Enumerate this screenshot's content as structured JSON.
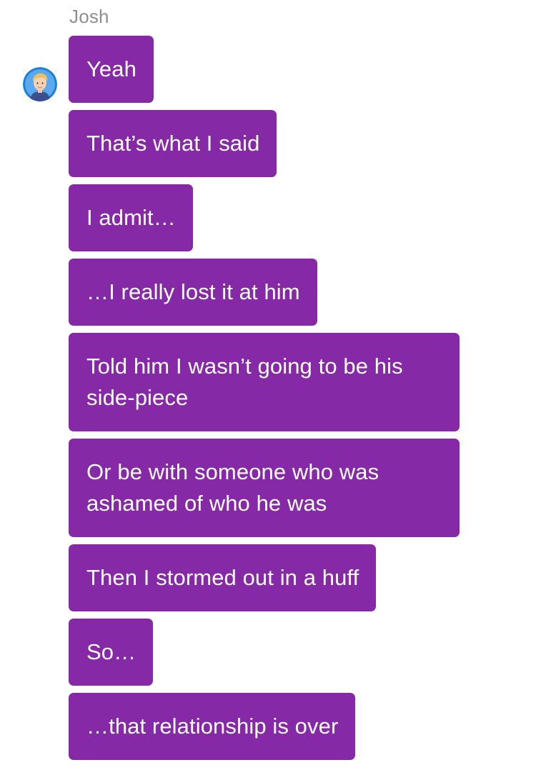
{
  "thread": {
    "sender_name": "Josh",
    "avatar_icon": "user-avatar-icon",
    "bubble_color": "#8629a6",
    "messages": [
      {
        "text": "Yeah"
      },
      {
        "text": "That’s what I said"
      },
      {
        "text": "I admit…"
      },
      {
        "text": "…I really lost it at him"
      },
      {
        "text": "Told him I wasn’t going to be his side-piece"
      },
      {
        "text": "Or be with someone who was ashamed of who he was"
      },
      {
        "text": "Then I stormed out in a huff"
      },
      {
        "text": "So…"
      },
      {
        "text": "…that relationship is over"
      }
    ]
  }
}
